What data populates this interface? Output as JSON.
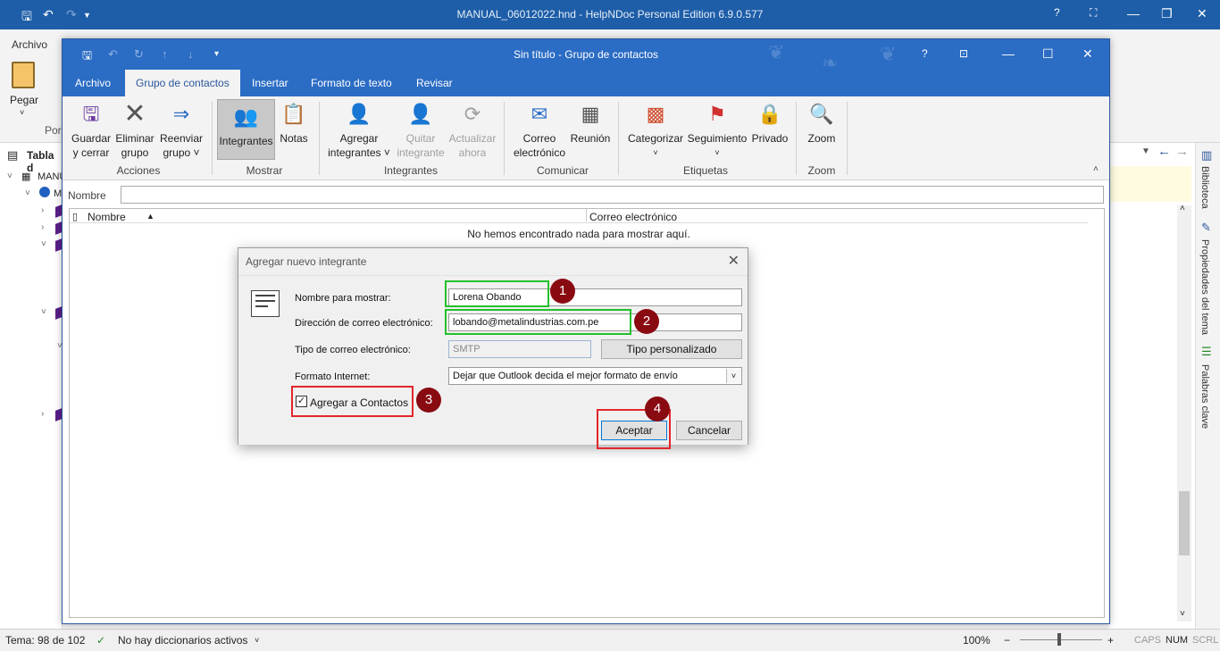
{
  "outer": {
    "title": "MANUAL_06012022.hnd - HelpNDoc Personal Edition 6.9.0.577",
    "archivo_label": "Archivo",
    "pegar_label": "Pegar",
    "por_label": "Por",
    "tabla_label": "Tabla d",
    "tree_root": "MANU",
    "tree_item": "M"
  },
  "right_tabs": [
    "Biblioteca",
    "Propiedades del tema",
    "Palabras clave"
  ],
  "status": {
    "tema": "Tema: 98 de 102",
    "dicc": "No hay diccionarios activos",
    "zoom": "100%",
    "caps": "CAPS",
    "num": "NUM",
    "scrl": "SCRL"
  },
  "cg": {
    "title": "Sin título  -  Grupo de contactos",
    "tabs": [
      "Archivo",
      "Grupo de contactos",
      "Insertar",
      "Formato de texto",
      "Revisar"
    ],
    "groups": {
      "acciones": "Acciones",
      "mostrar": "Mostrar",
      "integrantes": "Integrantes",
      "comunicar": "Comunicar",
      "etiquetas": "Etiquetas",
      "zoom": "Zoom"
    },
    "buttons": {
      "guardar": [
        "Guardar",
        "y cerrar"
      ],
      "eliminar": [
        "Eliminar",
        "grupo"
      ],
      "reenviar": [
        "Reenviar",
        "grupo ˅"
      ],
      "integrantes": "Integrantes",
      "notas": "Notas",
      "agregar": [
        "Agregar",
        "integrantes ˅"
      ],
      "quitar": [
        "Quitar",
        "integrante"
      ],
      "actualizar": [
        "Actualizar",
        "ahora"
      ],
      "correo": [
        "Correo",
        "electrónico"
      ],
      "reunion": "Reunión",
      "categorizar": "Categorizar",
      "seguimiento": "Seguimiento",
      "privado": "Privado",
      "zoom": "Zoom"
    },
    "nombre_label": "Nombre",
    "col_nombre": "Nombre",
    "col_correo": "Correo electrónico",
    "empty_msg": "No hemos encontrado nada para mostrar aquí."
  },
  "dialog": {
    "title": "Agregar nuevo integrante",
    "lbl_nombre": "Nombre para mostrar:",
    "val_nombre": "Lorena Obando",
    "lbl_correo": "Dirección de correo electrónico:",
    "val_correo": "lobando@metalindustrias.com.pe",
    "lbl_tipo": "Tipo de correo electrónico:",
    "val_tipo": "SMTP",
    "btn_tipo": "Tipo personalizado",
    "lbl_formato": "Formato Internet:",
    "val_formato": "Dejar que Outlook decida el mejor formato de envío",
    "chk_label": "Agregar a Contactos",
    "chk_checked": true,
    "btn_aceptar": "Aceptar",
    "btn_cancelar": "Cancelar",
    "badges": [
      "1",
      "2",
      "3",
      "4"
    ]
  },
  "colors": {
    "title_blue": "#2b6cc4",
    "outer_blue": "#1e5ea8",
    "highlight_green": "#23c02b",
    "highlight_red": "#e2252b",
    "badge_red": "#8a0a12"
  }
}
